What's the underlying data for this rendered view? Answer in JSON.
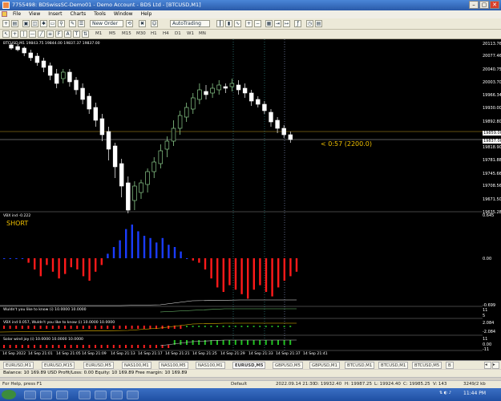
{
  "window": {
    "title": "7755498: BDSwissSC-Demo01 - Demo Account - BDS Ltd - [BTCUSD,M1]",
    "buttons": [
      "–",
      "▢",
      "✕"
    ]
  },
  "menu": [
    "File",
    "View",
    "Insert",
    "Charts",
    "Tools",
    "Window",
    "Help"
  ],
  "toolbar": {
    "new_order": "New Order",
    "autotrading": "AutoTrading"
  },
  "timeframes": [
    "M1",
    "M5",
    "M15",
    "M30",
    "H1",
    "H4",
    "D1",
    "W1",
    "MN"
  ],
  "chart": {
    "header": "BTCUSD,M1  19843.75 19844.00 19837.37 19837.00",
    "timer": "< 0:57 (2200.0)",
    "price_labels": [
      "20113.76",
      "20077.46",
      "20040.75",
      "20003.70",
      "19966.34",
      "19930.00",
      "19892.80",
      "19859.00",
      "19837.00",
      "19818.90",
      "19781.88",
      "19745.66",
      "19708.56",
      "19671.50",
      "19635.28"
    ],
    "time_labels": [
      "14 Sep 2022",
      "14 Sep 21:01",
      "14 Sep 21:05",
      "14 Sep 21:09",
      "14 Sep 21:13",
      "14 Sep 21:17",
      "14 Sep 21:21",
      "14 Sep 21:25",
      "14 Sep 21:29",
      "14 Sep 21:33",
      "14 Sep 21:37",
      "14 Sep 21:41"
    ]
  },
  "indicators": {
    "osc_label": "VBX ind -0.222",
    "signal": "SHORT",
    "osc_scale": [
      "0.645",
      "0.00",
      "-0.699"
    ],
    "ind2_label": "Wuldn't you like to know (i) 10.0000 10.0000",
    "ind2_scale": [
      "11",
      "5"
    ],
    "ind3_label": "VBX ind 0.057, Wuldn't you like to know (i) 10.0000 10.0000",
    "ind3_scale": [
      "2.084",
      "-2.084"
    ],
    "ind4_label": "Solar wind joy (i) 10.0000 10.0000 10.0000",
    "ind4_scale": [
      "11",
      "0.00",
      "-11"
    ]
  },
  "symbol_tabs": [
    "EURUSD,M1",
    "EURUSD,M15",
    "EURUSD,M5",
    "NAS100,M1",
    "NAS100,M5",
    "NAS100,M1",
    "EURUSD,M5",
    "GBPUSD,M5",
    "GBPUSD,M1",
    "BTCUSD,M1",
    "BTCUSD,M1",
    "BTCUSD,M5",
    "B"
  ],
  "balance": "Balance: 10 169.89 USD  Profit/Loss: 0.00  Equity: 10 169.89  Free margin: 10 169.89",
  "status": {
    "help": "For Help, press F1",
    "profile": "Default",
    "time": "2022.09.14 21:30",
    "open": "O: 19932.40",
    "high": "H: 19987.25",
    "low": "L: 19924.40",
    "close": "C: 19985.25",
    "volume": "V: 143",
    "traffic": "3249/2 kb"
  },
  "taskbar": {
    "clock": "11:44 PM"
  },
  "colors": {
    "chart_bg": "#000000",
    "bull_candle": "#ffffff",
    "bear_candle": "#ffffff",
    "osc_pos": "#1a3cff",
    "osc_neg": "#ff1a1a",
    "signal": "#f0c000"
  }
}
